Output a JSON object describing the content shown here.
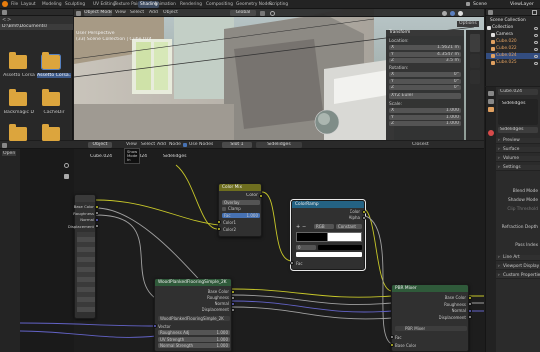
{
  "app": {
    "tabs": [
      "Layout",
      "Modeling",
      "Sculpting",
      "UV Editing",
      "Texture Paint",
      "Shading",
      "Animation",
      "Rendering",
      "Compositing",
      "Geometry Nodes",
      "Scripting"
    ],
    "active_tab": "Shading",
    "scene": "Scene",
    "view_layer": "ViewLayer"
  },
  "file_browser": {
    "path": "D:\\Bmt\\Documents\\",
    "folders": [
      "Assetto Corsa",
      "Assetto Corsa..."
    ],
    "folders2": [
      "Backmagic D",
      "CacheDir"
    ]
  },
  "viewport": {
    "mode": "Object Mode",
    "menus": [
      "View",
      "Select",
      "Add",
      "Object"
    ],
    "transform_space": "Global",
    "info_line1": "User Perspective",
    "info_line2": "(33) Scene Collection | Cube.024",
    "options_label": "Options",
    "transform": {
      "title": "Transform",
      "location_label": "Location:",
      "location": [
        {
          "axis": "X",
          "value": "1.5621 m"
        },
        {
          "axis": "Y",
          "value": "4.3547 m"
        },
        {
          "axis": "Z",
          "value": "3.5 m"
        }
      ],
      "rotation_label": "Rotation:",
      "rotation": [
        {
          "axis": "X",
          "value": "0°"
        },
        {
          "axis": "Y",
          "value": "0°"
        },
        {
          "axis": "Z",
          "value": "0°"
        }
      ],
      "rotation_mode": "XYZ Euler",
      "scale_label": "Scale:",
      "scale": [
        {
          "axis": "X",
          "value": "1.000"
        },
        {
          "axis": "Y",
          "value": "1.000"
        },
        {
          "axis": "Z",
          "value": "1.000"
        }
      ]
    }
  },
  "outliner": {
    "title": "Scene Collection",
    "items": [
      {
        "label": "Collection",
        "color": "#e0e0e0"
      },
      {
        "label": "Camera",
        "color": "#e0e0e0"
      },
      {
        "label": "Cube.020",
        "color": "#e0a060"
      },
      {
        "label": "Cube.022",
        "color": "#e0a060"
      },
      {
        "label": "Cube.024",
        "color": "#e0a060"
      },
      {
        "label": "Cube.025",
        "color": "#e0a060"
      }
    ]
  },
  "properties": {
    "object": "Cube.024",
    "material": "Sidelidges",
    "world": "Sidelidges",
    "sections": [
      "Preview",
      "Surface",
      "Volume",
      "Settings"
    ],
    "settings_rows": [
      "Blend Mode",
      "Shadow Mode",
      "Clip Threshold",
      "",
      "Refraction Depth",
      "",
      "Pass Index"
    ],
    "sections2": [
      "Line Art",
      "Viewport Display",
      "Custom Properties"
    ]
  },
  "node_editor": {
    "menus": [
      "View",
      "Select",
      "Add",
      "Node"
    ],
    "use_nodes": "Use Nodes",
    "slot": "Slot 1",
    "material": "Sidelidges",
    "object_label": "Object",
    "mode": "Closest",
    "breadcrumb": [
      "Cube.024",
      "Cube.024",
      "Sidelidges"
    ],
    "tooltip": "Show\nMode\nIn"
  },
  "nodes": {
    "color_mix": {
      "title": "Color Mix",
      "out": "Color",
      "mode": "Overlay",
      "clamp": "Clamp",
      "factor_label": "Fac",
      "factor": "1.000",
      "in1": "Color1",
      "in2": "Color2"
    },
    "color_ramp": {
      "title": "ColorRamp",
      "out_color": "Color",
      "out_alpha": "Alpha",
      "mode": "RGB",
      "interp": "Constant",
      "pos": "0",
      "fac": "Fac"
    },
    "texture": {
      "rows": [
        "Base Color",
        "Roughness",
        "Normal",
        "Displacement"
      ]
    },
    "wood_tex": {
      "title": "WoodPlankedFlooringSimple_2K",
      "outputs": [
        "Base Color",
        "Roughness",
        "Normal",
        "Displacement"
      ],
      "subtitle": "WoodPlankedFlooringSimple_2K",
      "vector": "Vector",
      "fields": [
        {
          "label": "Roughness Adj",
          "value": "1.000"
        },
        {
          "label": "UV Strength",
          "value": "1.000"
        },
        {
          "label": "Normal Strength",
          "value": "1.000"
        }
      ]
    },
    "pbr_mixer": {
      "title": "PBR Mixer",
      "inputs": [
        "Base Color",
        "Roughness",
        "Normal",
        "Displacement"
      ],
      "subtitle": "PBR Mixer",
      "fac": "Fac",
      "color": "Base Color"
    }
  }
}
